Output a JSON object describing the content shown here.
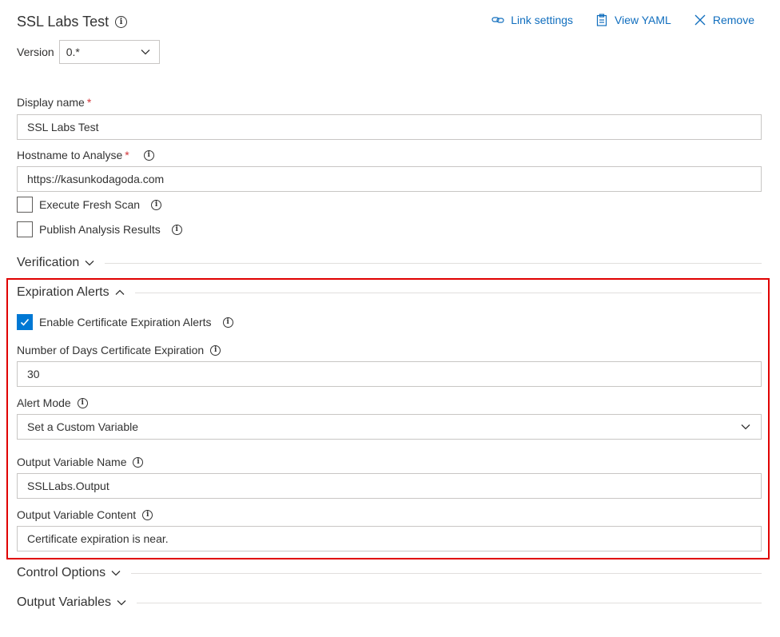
{
  "task": {
    "title": "SSL Labs Test",
    "info_glyph": "i"
  },
  "actions": {
    "link_settings": "Link settings",
    "view_yaml": "View YAML",
    "remove": "Remove"
  },
  "version": {
    "label": "Version",
    "value": "0.*"
  },
  "fields": {
    "display_name": {
      "label": "Display name",
      "required_mark": "*",
      "value": "SSL Labs Test"
    },
    "hostname": {
      "label": "Hostname to Analyse",
      "required_mark": "*",
      "value": "https://kasunkodagoda.com"
    },
    "fresh_scan": {
      "label": "Execute Fresh Scan",
      "checked": false
    },
    "publish_results": {
      "label": "Publish Analysis Results",
      "checked": false
    }
  },
  "sections": {
    "verification": "Verification",
    "expiration_alerts": "Expiration Alerts",
    "control_options": "Control Options",
    "output_variables": "Output Variables"
  },
  "expiration": {
    "enable_alerts": {
      "label": "Enable Certificate Expiration Alerts",
      "checked": true
    },
    "days": {
      "label": "Number of Days Certificate Expiration",
      "value": "30"
    },
    "alert_mode": {
      "label": "Alert Mode",
      "value": "Set a Custom Variable"
    },
    "output_var_name": {
      "label": "Output Variable Name",
      "value": "SSLLabs.Output"
    },
    "output_var_content": {
      "label": "Output Variable Content",
      "value": "Certificate expiration is near."
    }
  },
  "colors": {
    "accent": "#0078d4",
    "link": "#106ebe",
    "highlight": "#e00000",
    "required": "#d13438"
  }
}
